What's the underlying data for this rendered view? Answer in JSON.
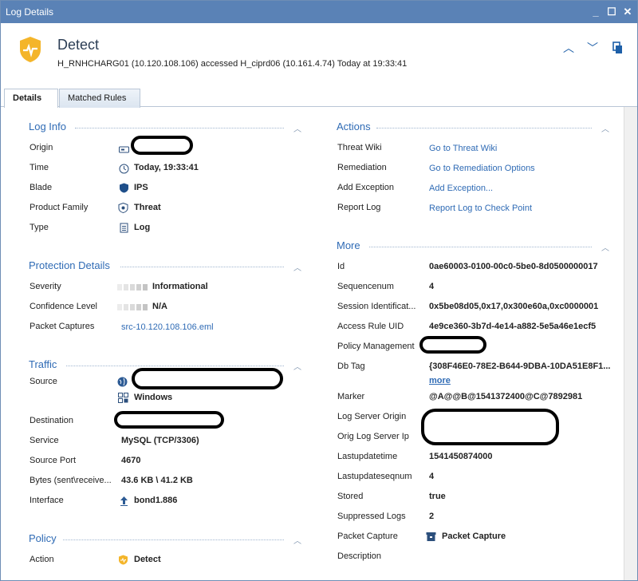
{
  "window": {
    "title": "Log Details"
  },
  "header": {
    "title": "Detect",
    "subtitle": "H_RNHCHARG01 (10.120.108.106) accessed H_ciprd06 (10.161.4.74) Today at 19:33:41"
  },
  "tabs": [
    {
      "label": "Details"
    },
    {
      "label": "Matched Rules"
    }
  ],
  "log_info": {
    "title": "Log Info",
    "rows": [
      {
        "label": "Origin",
        "value": ""
      },
      {
        "label": "Time",
        "value": "Today, 19:33:41"
      },
      {
        "label": "Blade",
        "value": "IPS"
      },
      {
        "label": "Product Family",
        "value": "Threat"
      },
      {
        "label": "Type",
        "value": "Log"
      }
    ]
  },
  "protection": {
    "title": "Protection Details",
    "rows": [
      {
        "label": "Severity",
        "value": "Informational"
      },
      {
        "label": "Confidence Level",
        "value": "N/A"
      },
      {
        "label": "Packet Captures",
        "value": "src-10.120.108.106.eml"
      }
    ]
  },
  "traffic": {
    "title": "Traffic",
    "rows": [
      {
        "label": "Source",
        "value": ""
      },
      {
        "label": "",
        "value": "Windows"
      },
      {
        "label": "Destination",
        "value": ""
      },
      {
        "label": "Service",
        "value": "MySQL (TCP/3306)"
      },
      {
        "label": "Source Port",
        "value": "4670"
      },
      {
        "label": "Bytes (sent\\receive...",
        "value": "43.6 KB \\ 41.2 KB"
      },
      {
        "label": "Interface",
        "value": "bond1.886"
      }
    ]
  },
  "policy": {
    "title": "Policy",
    "rows": [
      {
        "label": "Action",
        "value": "Detect"
      }
    ]
  },
  "actions": {
    "title": "Actions",
    "rows": [
      {
        "label": "Threat Wiki",
        "value": "Go to Threat Wiki"
      },
      {
        "label": "Remediation",
        "value": "Go to Remediation Options"
      },
      {
        "label": "Add Exception",
        "value": "Add Exception..."
      },
      {
        "label": "Report Log",
        "value": "Report Log to Check Point"
      }
    ]
  },
  "more": {
    "title": "More",
    "rows": [
      {
        "label": "Id",
        "value": "0ae60003-0100-00c0-5be0-8d0500000017"
      },
      {
        "label": "Sequencenum",
        "value": "4"
      },
      {
        "label": "Session Identificat...",
        "value": "0x5be08d05,0x17,0x300e60a,0xc0000001"
      },
      {
        "label": "Access Rule UID",
        "value": "4e9ce360-3b7d-4e14-a882-5e5a46e1ecf5"
      },
      {
        "label": "Policy Management",
        "value": ""
      },
      {
        "label": "Db Tag",
        "value": "{308F46E0-78E2-B644-9DBA-10DA51E8F1...",
        "extra": "more"
      },
      {
        "label": "Marker",
        "value": "@A@@B@1541372400@C@7892981"
      },
      {
        "label": "Log Server Origin",
        "value": ""
      },
      {
        "label": "Orig Log Server Ip",
        "value": ""
      },
      {
        "label": "Lastupdatetime",
        "value": "1541450874000"
      },
      {
        "label": "Lastupdateseqnum",
        "value": "4"
      },
      {
        "label": "Stored",
        "value": "true"
      },
      {
        "label": "Suppressed Logs",
        "value": "2"
      },
      {
        "label": "Packet Capture",
        "value": "Packet Capture"
      },
      {
        "label": "Description",
        "value": ""
      }
    ]
  }
}
